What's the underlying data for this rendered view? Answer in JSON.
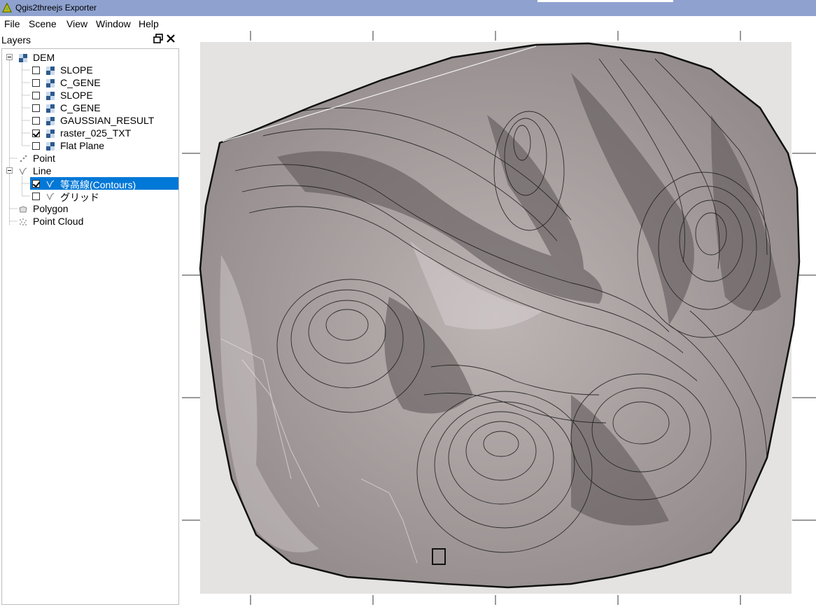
{
  "window": {
    "title": "Qgis2threejs Exporter"
  },
  "menu": [
    "File",
    "Scene",
    "View",
    "Window",
    "Help"
  ],
  "layers_panel": {
    "title": "Layers",
    "groups": [
      {
        "label": "DEM",
        "items": [
          {
            "label": "SLOPE",
            "checked": false
          },
          {
            "label": "C_GENE",
            "checked": false
          },
          {
            "label": "SLOPE",
            "checked": false
          },
          {
            "label": "C_GENE",
            "checked": false
          },
          {
            "label": "GAUSSIAN_RESULT",
            "checked": false
          },
          {
            "label": "raster_025_TXT",
            "checked": true
          },
          {
            "label": "Flat Plane",
            "checked": false
          }
        ]
      },
      {
        "label": "Point",
        "items": []
      },
      {
        "label": "Line",
        "items": [
          {
            "label": "等高線(Contours)",
            "checked": true,
            "selected": true
          },
          {
            "label": "グリッド",
            "checked": false
          }
        ]
      },
      {
        "label": "Polygon",
        "items": []
      },
      {
        "label": "Point Cloud",
        "items": []
      }
    ]
  },
  "colors": {
    "titlebar": "#8fa2cf",
    "selection": "#0078d7",
    "terrain": "#a8a0a0",
    "contour": "#1a1a1a",
    "scene_bg": "#e4e3e1"
  }
}
